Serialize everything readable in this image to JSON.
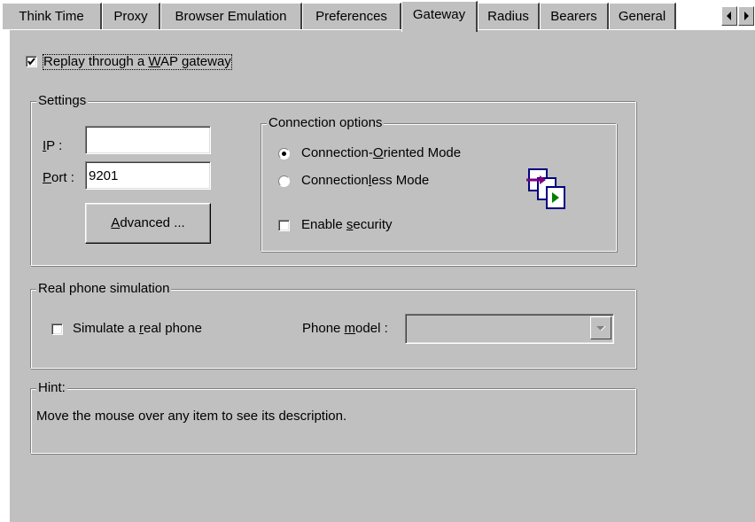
{
  "tabs": [
    {
      "label": "Think Time",
      "active": false
    },
    {
      "label": "Proxy",
      "active": false
    },
    {
      "label": "Browser Emulation",
      "active": false
    },
    {
      "label": "Preferences",
      "active": false
    },
    {
      "label": "Gateway",
      "active": true
    },
    {
      "label": "Radius",
      "active": false
    },
    {
      "label": "Bearers",
      "active": false
    },
    {
      "label": "General",
      "active": false
    }
  ],
  "replay": {
    "label_pre": "Replay through a ",
    "label_u": "W",
    "label_post": "AP gateway",
    "checked": true
  },
  "settings": {
    "title": "Settings",
    "ip": {
      "label_u": "I",
      "label_post": "P :",
      "value": ""
    },
    "port": {
      "label_u": "P",
      "label_post": "ort :",
      "value": "9201"
    },
    "advanced": {
      "label_u": "A",
      "label_post": "dvanced ..."
    }
  },
  "connection": {
    "title": "Connection options",
    "oriented": {
      "pre": "Connection-",
      "u": "O",
      "post": "riented Mode",
      "selected": true
    },
    "connectionless": {
      "pre": "Connection",
      "u": "l",
      "post": "ess Mode",
      "selected": false
    },
    "security": {
      "pre": "Enable ",
      "u": "s",
      "post": "ecurity",
      "checked": false
    },
    "icon": "connection-mode-icon"
  },
  "phone": {
    "title": "Real phone simulation",
    "simulate": {
      "pre": "Simulate a ",
      "u": "r",
      "post": "eal phone",
      "checked": false
    },
    "model": {
      "pre": "Phone ",
      "u": "m",
      "post": "odel :",
      "value": ""
    }
  },
  "hint": {
    "title": "Hint:",
    "text": "Move the mouse over any item to see its description."
  },
  "icons": {
    "scroll_left": "scroll-left-icon",
    "scroll_right": "scroll-right-icon",
    "dropdown": "chevron-down-icon"
  },
  "colors": {
    "face": "#c0c0c0",
    "shadow": "#808080",
    "highlight": "#ffffff",
    "icon_purple": "#800080",
    "icon_green": "#008000",
    "icon_blue": "#000080"
  }
}
